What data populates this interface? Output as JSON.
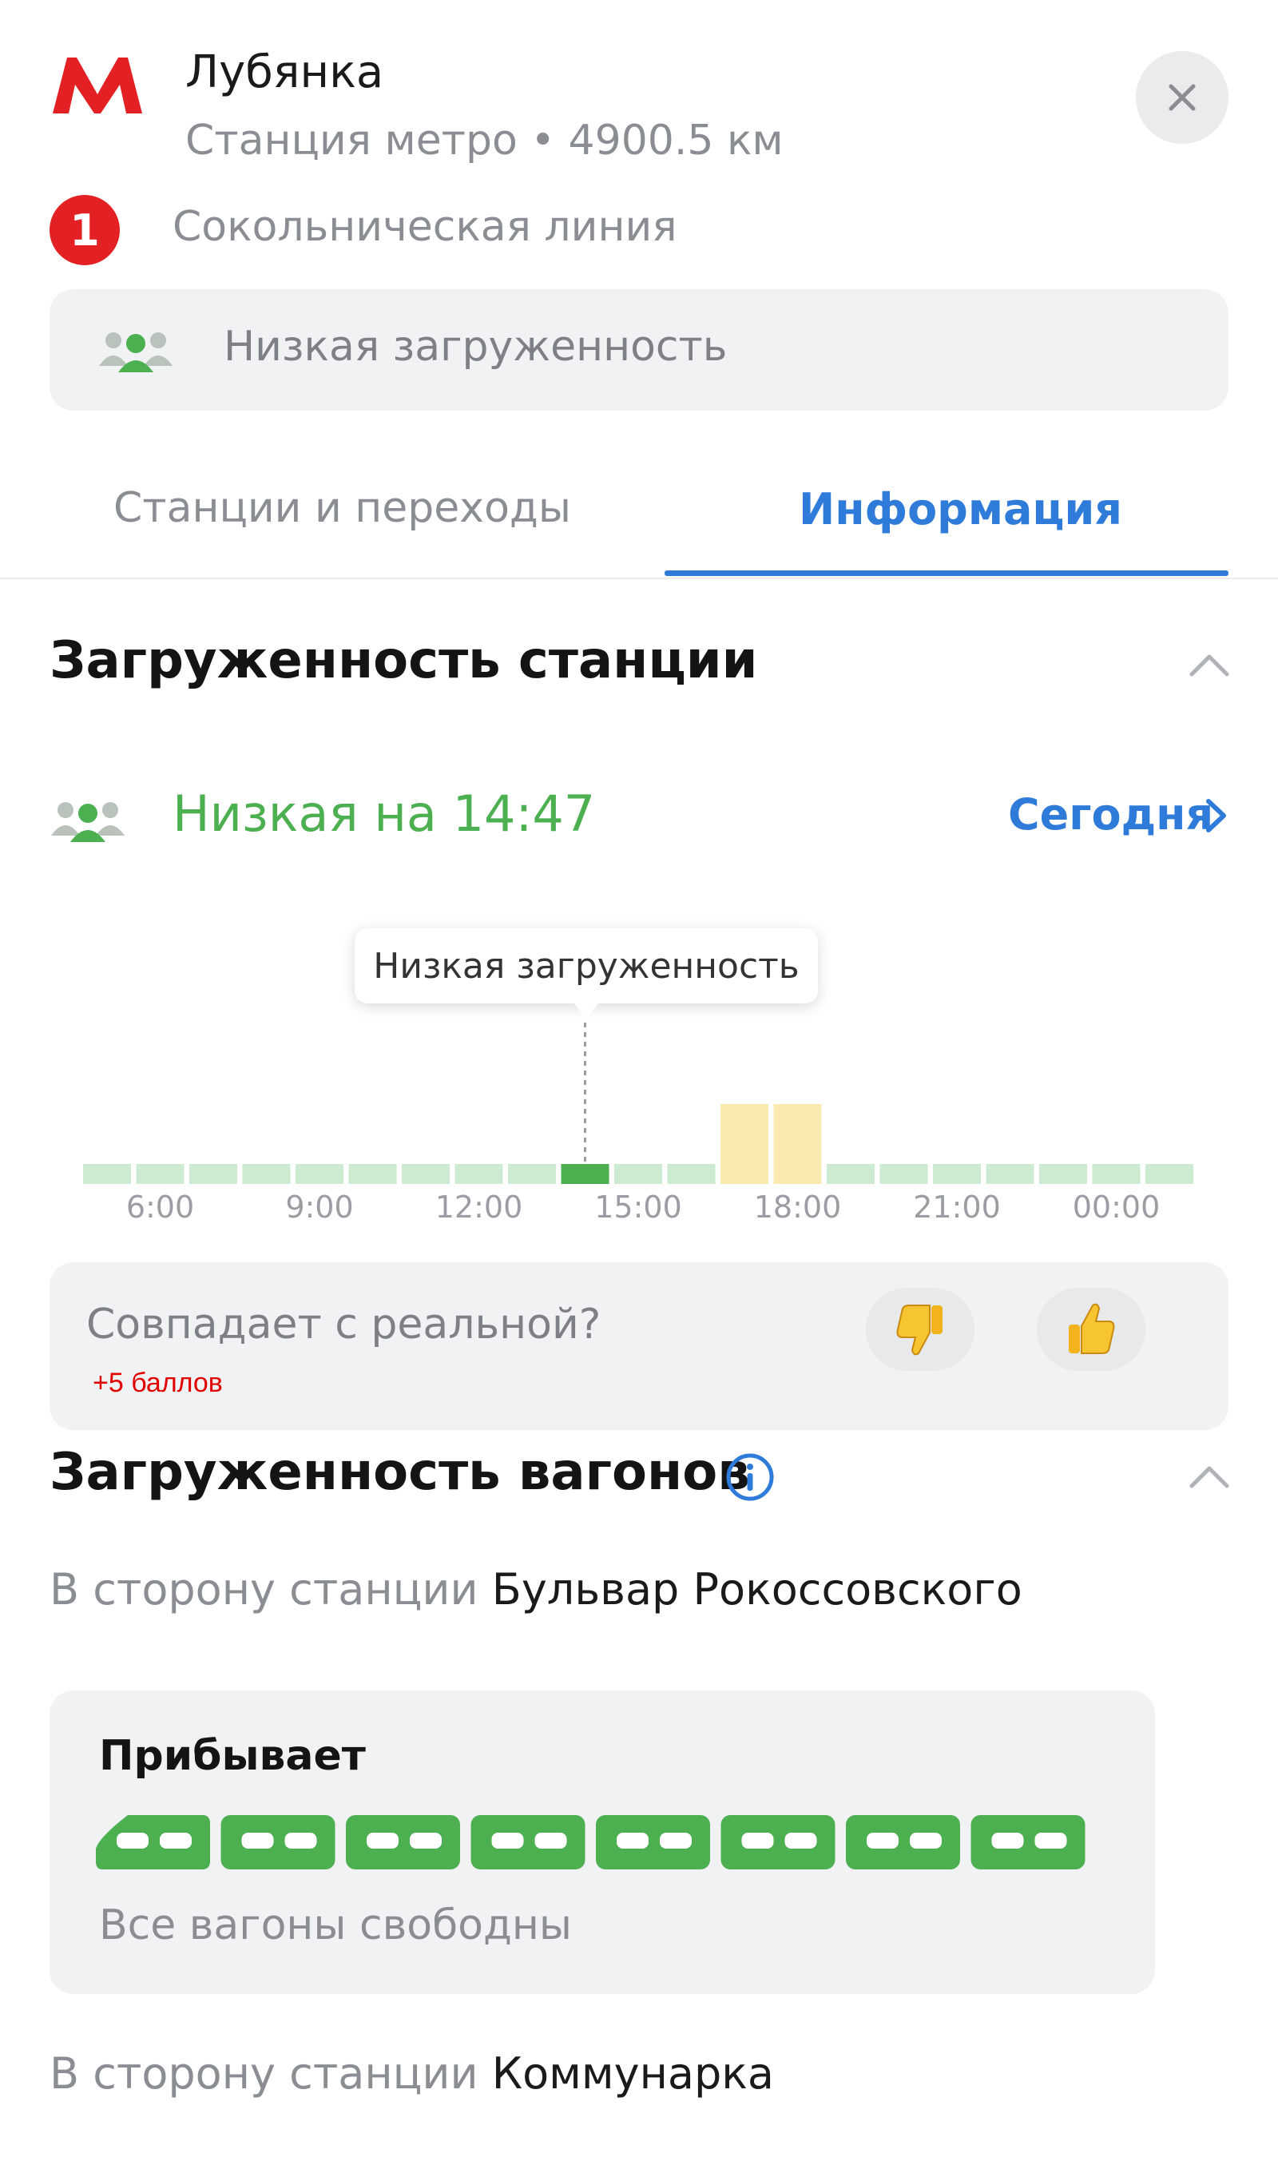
{
  "header": {
    "station_name": "Лубянка",
    "station_subtitle": "Станция метро • 4900.5 км",
    "line_number": "1",
    "line_name": "Сокольническая линия",
    "line_color": "#e32124",
    "logo_icon": "metro-m-logo",
    "close_icon": "close-icon"
  },
  "load_panel": {
    "icon": "people-icon",
    "text": "Низкая загруженность"
  },
  "tabs": [
    {
      "label": "Станции и переходы",
      "active": false
    },
    {
      "label": "Информация",
      "active": true
    }
  ],
  "station_load": {
    "title": "Загруженность станции",
    "status": "Низкая на 14:47",
    "status_color": "#4caf50",
    "day_selector": "Сегодня",
    "tooltip": "Низкая загруженность",
    "chart_data": {
      "type": "bar",
      "tick_labels": [
        "6:00",
        "9:00",
        "12:00",
        "15:00",
        "18:00",
        "21:00",
        "00:00"
      ],
      "levels": [
        "low",
        "low",
        "low",
        "low",
        "low",
        "low",
        "low",
        "low",
        "low",
        "current",
        "low",
        "low",
        "medium",
        "medium",
        "low",
        "low",
        "low",
        "low",
        "low",
        "low",
        "low"
      ],
      "level_values": {
        "low": 1,
        "current": 1,
        "medium": 4
      },
      "colors": {
        "low": "#cdebd0",
        "current": "#4caf50",
        "medium": "#fbeab0"
      },
      "current_time": "14:47"
    }
  },
  "feedback": {
    "question": "Совпадает с реальной?",
    "points": "+5 баллов",
    "thumb_down": "👎",
    "thumb_up": "👍"
  },
  "car_load": {
    "title": "Загруженность вагонов",
    "info_icon": "info-icon",
    "directions": [
      {
        "prefix": "В сторону станции",
        "station": "Бульвар Рокоссовского",
        "arrives_label": "Прибывает",
        "car_count": 8,
        "status": "Все вагоны свободны"
      },
      {
        "prefix": "В сторону станции",
        "station": "Коммунарка"
      }
    ]
  }
}
